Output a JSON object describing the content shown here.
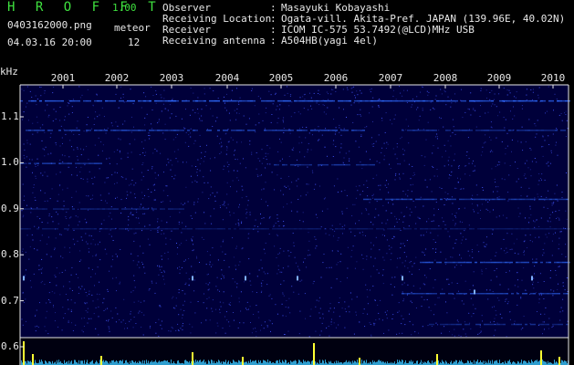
{
  "header": {
    "app_title": "H R O F F T",
    "version": "1.00",
    "filename": "0403162000.png",
    "meteor_label": "meteor",
    "datetime": "04.03.16 20:00",
    "meteor_count": "12"
  },
  "info": [
    {
      "key": "Observer",
      "sep": ":",
      "value": "Masayuki Kobayashi"
    },
    {
      "key": "Receiving Location",
      "sep": ":",
      "value": "Ogata-vill. Akita-Pref. JAPAN (139.96E, 40.02N)"
    },
    {
      "key": "Receiver",
      "sep": ":",
      "value": "ICOM IC-575 53.7492(@LCD)MHz USB"
    },
    {
      "key": "Receiving antenna",
      "sep": ":",
      "value": "A504HB(yagi 4el)"
    }
  ],
  "chart_data": {
    "type": "heatmap",
    "ylabel": "kHz",
    "y_ticks": [
      "1.1",
      "1.0",
      "0.9",
      "0.8",
      "0.7",
      "0.6"
    ],
    "x_ticks": [
      "2001",
      "2002",
      "2003",
      "2004",
      "2005",
      "2006",
      "2007",
      "2008",
      "2009",
      "2010"
    ],
    "background_color": "#00003a",
    "echo_color": "#2f6bff",
    "lower_panel_color": "#39c5ff",
    "spike_color": "#ffff33"
  }
}
